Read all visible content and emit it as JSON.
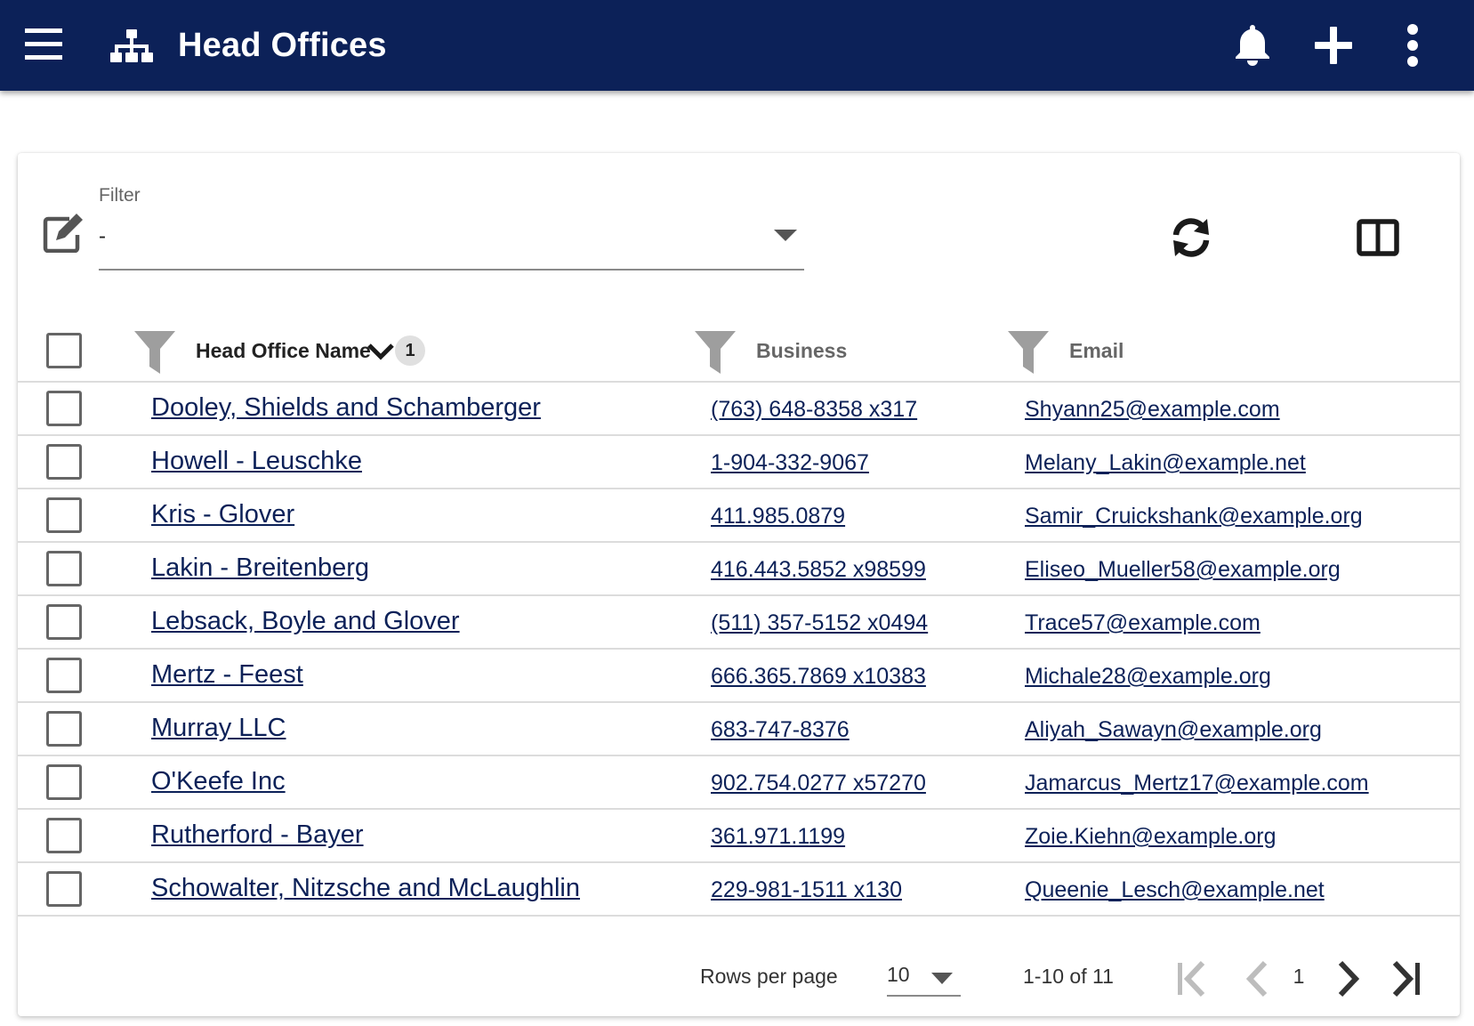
{
  "app_bar": {
    "title": "Head Offices",
    "icons": [
      "menu-icon",
      "org-chart-icon",
      "bell-icon",
      "plus-icon",
      "more-vert-icon"
    ]
  },
  "filter": {
    "label": "Filter",
    "value": "-"
  },
  "toolbar_icons": [
    "edit-icon",
    "refresh-icon",
    "columns-icon"
  ],
  "table": {
    "columns": [
      {
        "label": "Head Office Name",
        "sort": "descending",
        "sort_order": "1"
      },
      {
        "label": "Business"
      },
      {
        "label": "Email"
      }
    ],
    "rows": [
      {
        "name": "Dooley, Shields and Schamberger",
        "business": "(763) 648-8358 x317",
        "email": "Shyann25@example.com"
      },
      {
        "name": "Howell - Leuschke",
        "business": "1-904-332-9067",
        "email": "Melany_Lakin@example.net"
      },
      {
        "name": "Kris - Glover",
        "business": "411.985.0879",
        "email": "Samir_Cruickshank@example.org"
      },
      {
        "name": "Lakin - Breitenberg",
        "business": "416.443.5852 x98599",
        "email": "Eliseo_Mueller58@example.org"
      },
      {
        "name": "Lebsack, Boyle and Glover",
        "business": "(511) 357-5152 x0494",
        "email": "Trace57@example.com"
      },
      {
        "name": "Mertz - Feest",
        "business": "666.365.7869 x10383",
        "email": "Michale28@example.org"
      },
      {
        "name": "Murray LLC",
        "business": "683-747-8376",
        "email": "Aliyah_Sawayn@example.org"
      },
      {
        "name": "O'Keefe Inc",
        "business": "902.754.0277 x57270",
        "email": "Jamarcus_Mertz17@example.com"
      },
      {
        "name": "Rutherford - Bayer",
        "business": "361.971.1199",
        "email": "Zoie.Kiehn@example.org"
      },
      {
        "name": "Schowalter, Nitzsche and McLaughlin",
        "business": "229-981-1511 x130",
        "email": "Queenie_Lesch@example.net"
      }
    ]
  },
  "pagination": {
    "rows_per_page_label": "Rows per page",
    "rows_per_page": "10",
    "range": "1-10 of 11",
    "page": "1"
  },
  "colors": {
    "app_bar": "#0c2158",
    "link": "#0c2158",
    "divider": "#dcdcdc"
  }
}
